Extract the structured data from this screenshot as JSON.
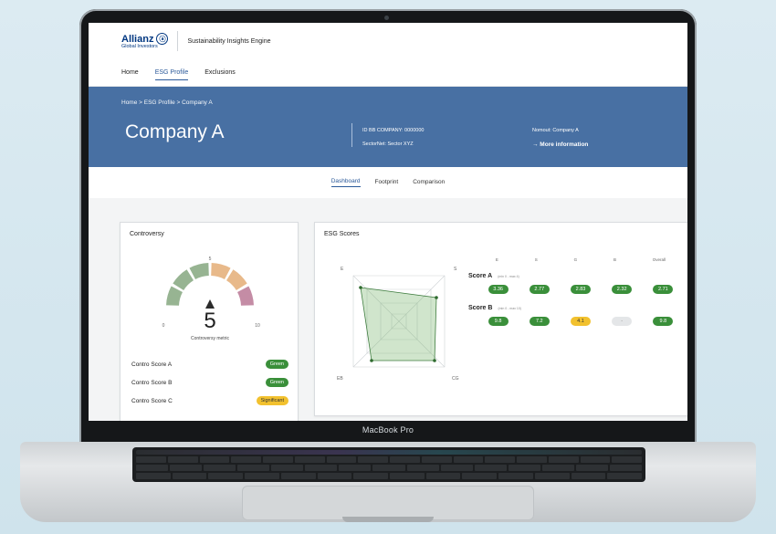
{
  "app": {
    "brand": "Allianz",
    "brand_mark": "ⓐ",
    "brand_sub": "Global Investors",
    "title": "Sustainability Insights Engine"
  },
  "nav": [
    "Home",
    "ESG Profile",
    "Exclusions"
  ],
  "hero": {
    "breadcrumb": "Home > ESG Profile > Company A",
    "company": "Company A",
    "id_label": "ID BB COMPANY: 0000000",
    "sector_label": "SectorNet: Sector XYZ",
    "name_label": "Nomout: Company A",
    "more_info": "→  More information"
  },
  "subtabs": [
    "Dashboard",
    "Footprint",
    "Comparison"
  ],
  "controversy": {
    "title": "Controversy",
    "value": "5",
    "metric_label": "Controversy metric",
    "scale_min": "0",
    "scale_mid": "5",
    "scale_max": "10",
    "segment_colors": [
      "#97b492",
      "#97b492",
      "#97b492",
      "#e8b98a",
      "#e8b98a",
      "#c48ca5"
    ],
    "rows": [
      {
        "label": "Contro Score A",
        "status": "Green",
        "color": "green"
      },
      {
        "label": "Contro Score B",
        "status": "Green",
        "color": "green"
      },
      {
        "label": "Contro Score C",
        "status": "Significant",
        "color": "yellow"
      }
    ]
  },
  "esg": {
    "title": "ESG Scores",
    "radar_labels": {
      "top_left": "E",
      "top_right": "S",
      "bottom_left": "EB",
      "bottom_right": "CG"
    },
    "columns": [
      "E",
      "S",
      "G",
      "B",
      "Overall"
    ],
    "scores": [
      {
        "name": "Score A",
        "range": "(min 0 - max 4)",
        "values": [
          "3.36",
          "2.77",
          "2.83",
          "2.32",
          "2.71"
        ],
        "styles": [
          "green",
          "green",
          "green",
          "green",
          "green"
        ]
      },
      {
        "name": "Score B",
        "range": "(min 0 - max 10)",
        "values": [
          "9.8",
          "7.2",
          "4.1",
          "-",
          "9.8"
        ],
        "styles": [
          "green",
          "green",
          "yellow",
          "grey",
          "green"
        ]
      }
    ]
  },
  "device": {
    "model": "MacBook Pro"
  }
}
